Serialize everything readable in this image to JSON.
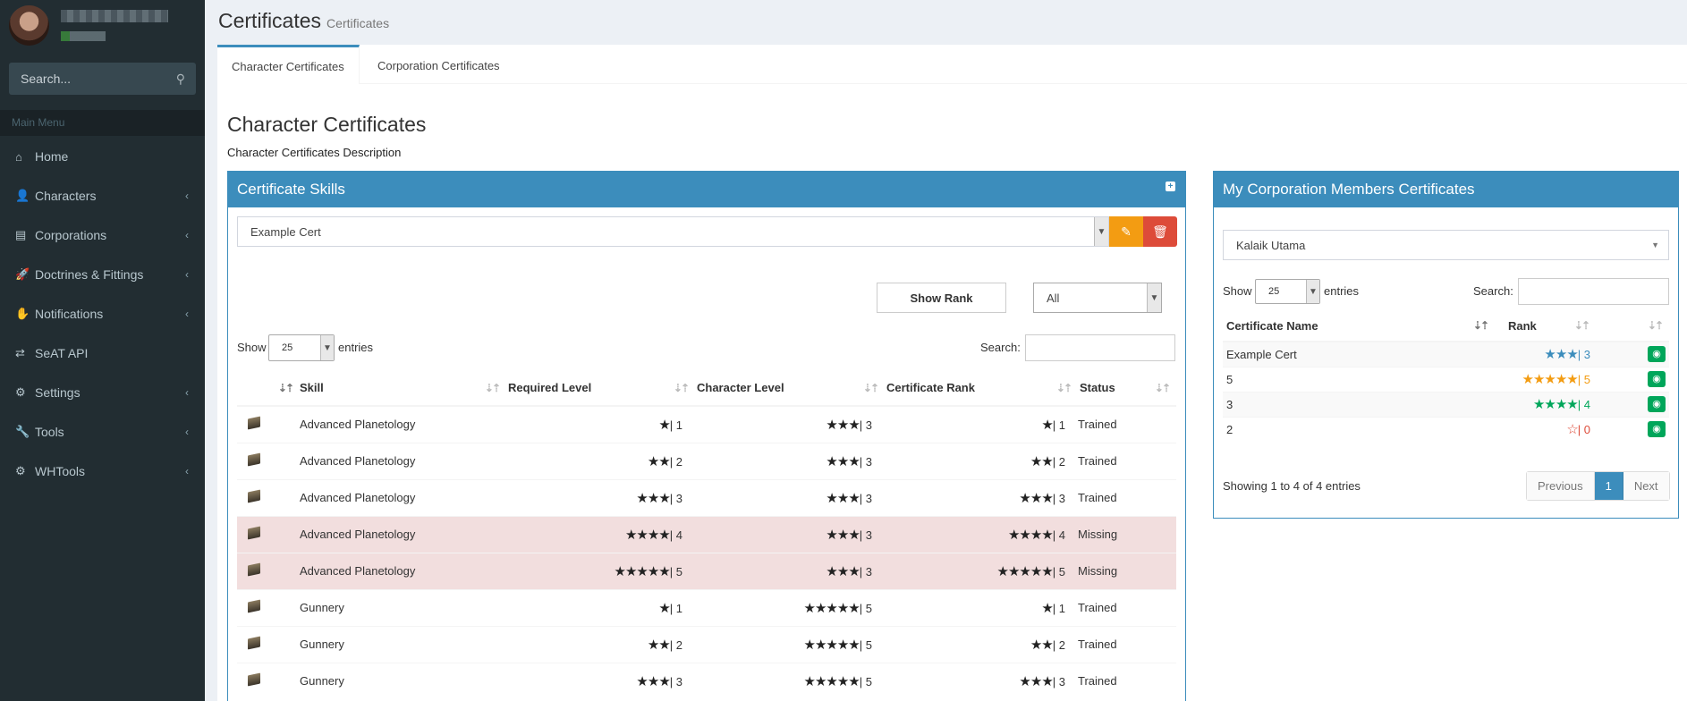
{
  "sidebar": {
    "search_placeholder": "Search...",
    "menu_header": "Main Menu",
    "items": [
      {
        "label": "Home",
        "icon": "home-icon",
        "glyph": "⌂",
        "has_children": false
      },
      {
        "label": "Characters",
        "icon": "user-icon",
        "glyph": "👤",
        "has_children": true
      },
      {
        "label": "Corporations",
        "icon": "building-icon",
        "glyph": "▤",
        "has_children": true
      },
      {
        "label": "Doctrines & Fittings",
        "icon": "rocket-icon",
        "glyph": "🚀",
        "has_children": true
      },
      {
        "label": "Notifications",
        "icon": "hand-icon",
        "glyph": "✋",
        "has_children": true
      },
      {
        "label": "SeAT API",
        "icon": "exchange-icon",
        "glyph": "⇄",
        "has_children": false
      },
      {
        "label": "Settings",
        "icon": "cogs-icon",
        "glyph": "⚙",
        "has_children": true
      },
      {
        "label": "Tools",
        "icon": "wrench-icon",
        "glyph": "🔧",
        "has_children": true
      },
      {
        "label": "WHTools",
        "icon": "gear-icon",
        "glyph": "⚙",
        "has_children": true
      }
    ]
  },
  "header": {
    "title": "Certificates",
    "subtitle": "Certificates"
  },
  "tabs": [
    {
      "label": "Character Certificates",
      "active": true
    },
    {
      "label": "Corporation Certificates",
      "active": false
    }
  ],
  "main": {
    "heading": "Character Certificates",
    "description": "Character Certificates Description"
  },
  "skills_panel": {
    "title": "Certificate Skills",
    "selected_cert": "Example Cert",
    "show_rank_label": "Show Rank",
    "filter_value": "All",
    "show_label": "Show",
    "entries_label": "entries",
    "page_length": "25",
    "search_label": "Search:",
    "columns": [
      "Skill",
      "Required Level",
      "Character Level",
      "Certificate Rank",
      "Status"
    ],
    "rows": [
      {
        "skill": "Advanced Planetology",
        "required": 1,
        "character": 3,
        "rank": 1,
        "status": "Trained"
      },
      {
        "skill": "Advanced Planetology",
        "required": 2,
        "character": 3,
        "rank": 2,
        "status": "Trained"
      },
      {
        "skill": "Advanced Planetology",
        "required": 3,
        "character": 3,
        "rank": 3,
        "status": "Trained"
      },
      {
        "skill": "Advanced Planetology",
        "required": 4,
        "character": 3,
        "rank": 4,
        "status": "Missing"
      },
      {
        "skill": "Advanced Planetology",
        "required": 5,
        "character": 3,
        "rank": 5,
        "status": "Missing"
      },
      {
        "skill": "Gunnery",
        "required": 1,
        "character": 5,
        "rank": 1,
        "status": "Trained"
      },
      {
        "skill": "Gunnery",
        "required": 2,
        "character": 5,
        "rank": 2,
        "status": "Trained"
      },
      {
        "skill": "Gunnery",
        "required": 3,
        "character": 5,
        "rank": 3,
        "status": "Trained"
      }
    ]
  },
  "corp_panel": {
    "title": "My Corporation Members Certificates",
    "selected_member": "Kalaik Utama",
    "show_label": "Show",
    "entries_label": "entries",
    "page_length": "25",
    "search_label": "Search:",
    "columns": [
      "Certificate Name",
      "Rank"
    ],
    "rows": [
      {
        "name": "Example Cert",
        "rank": 3,
        "color": "#3c8dbc",
        "empty": false
      },
      {
        "name": "5",
        "rank": 5,
        "color": "#f39c12",
        "empty": false
      },
      {
        "name": "3",
        "rank": 4,
        "color": "#00a65a",
        "empty": false
      },
      {
        "name": "2",
        "rank": 0,
        "color": "#dd4b39",
        "empty": true
      }
    ],
    "info": "Showing 1 to 4 of 4 entries",
    "pager": {
      "prev": "Previous",
      "current": "1",
      "next": "Next"
    }
  }
}
